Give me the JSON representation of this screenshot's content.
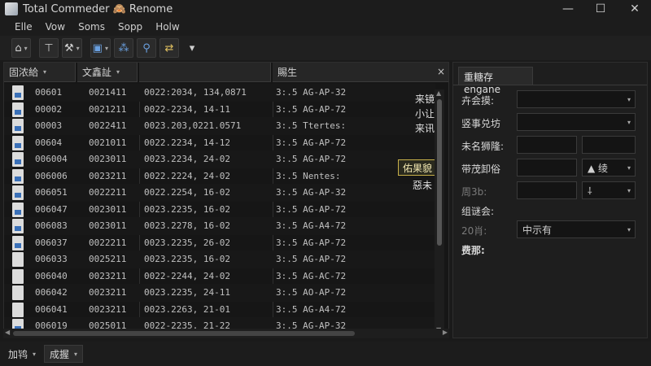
{
  "window": {
    "title": "Total Commeder 🙈 Renome",
    "minimize_glyph": "—",
    "maximize_glyph": "☐",
    "close_glyph": "✕"
  },
  "menu": [
    "Elle",
    "Vow",
    "Soms",
    "Sopp",
    "Holw"
  ],
  "toolbar": {
    "icons": [
      "home-icon",
      "filter-icon",
      "tools-icon",
      "view-icon",
      "network-icon",
      "search-icon",
      "sync-icon"
    ],
    "home_glyph": "⌂",
    "filter_glyph": "⊤",
    "tools_glyph": "⚒",
    "view_glyph": "▣",
    "network_glyph": "⁂",
    "search_glyph": "⚲",
    "sync_glyph": "⇄",
    "more_glyph": "▾"
  },
  "file_list": {
    "headers": [
      "固浓給",
      "文鑫訨",
      "",
      "賜生"
    ],
    "rows": [
      {
        "id": "00601",
        "code": "0021411",
        "date": "0022:2034, 134,0871",
        "attr": "3:.5 AG-AP-32",
        "icon": "dark"
      },
      {
        "id": "00002",
        "code": "0021211",
        "date": "0022-2234, 14-11",
        "attr": "3:.5 AG-AP-72",
        "icon": "dark"
      },
      {
        "id": "00003",
        "code": "0022411",
        "date": "0023.203,0221.0571",
        "attr": "3:.5 Ttertes:",
        "icon": "dark"
      },
      {
        "id": "00604",
        "code": "0021011",
        "date": "0022.2234, 14-12",
        "attr": "3:.5 AG-AP-72",
        "icon": "dark"
      },
      {
        "id": "006004",
        "code": "0023011",
        "date": "0023.2234, 24-02",
        "attr": "3:.5 AG-AP-72",
        "icon": "dark"
      },
      {
        "id": "006006",
        "code": "0023211",
        "date": "0022.2224, 24-02",
        "attr": "3:.5 Nentes:",
        "icon": "dark"
      },
      {
        "id": "006051",
        "code": "0022211",
        "date": "0022.2254, 16-02",
        "attr": "3:.5 AG-AP-32",
        "icon": "dark"
      },
      {
        "id": "006047",
        "code": "0023011",
        "date": "0023.2235, 16-02",
        "attr": "3:.5 AG-AP-72",
        "icon": "dark"
      },
      {
        "id": "006083",
        "code": "0023011",
        "date": "0023.2278, 16-02",
        "attr": "3:.5 AG-A4-72",
        "icon": "dark"
      },
      {
        "id": "006037",
        "code": "0022211",
        "date": "0023.2235, 26-02",
        "attr": "3:.5 AG-AP-72",
        "icon": "dark"
      },
      {
        "id": "006033",
        "code": "0025211",
        "date": "0023.2235, 16-02",
        "attr": "3:.5 AG-AP-72",
        "icon": "light"
      },
      {
        "id": "006040",
        "code": "0023211",
        "date": "0022-2244, 24-02",
        "attr": "3:.5 AG-AC-72",
        "icon": "light"
      },
      {
        "id": "006042",
        "code": "0023211",
        "date": "0023.2235, 24-11",
        "attr": "3:.5 AO-AP-72",
        "icon": "light"
      },
      {
        "id": "006041",
        "code": "0023211",
        "date": "0023.2263, 21-01",
        "attr": "3:.5 AG-A4-72",
        "icon": "light"
      },
      {
        "id": "006019",
        "code": "0025011",
        "date": "0022-2235, 21-22",
        "attr": "3:.5 AG-AP-32",
        "icon": "dark"
      }
    ],
    "side_notes": [
      "来镜",
      "小让",
      "来讯"
    ],
    "highlight": "佑果貌",
    "highlight_note": "惡未",
    "close_glyph": "×"
  },
  "properties": {
    "tab": "重糖存engane",
    "labels": {
      "l1": "卉会摸:",
      "l2": "竖事兑坊",
      "l3": "未名狮隆:",
      "l4": "带茂卸俗",
      "l5": "周3b:",
      "l6": "组谜会:",
      "l7": "20肖:",
      "l8": "费那:"
    },
    "values": {
      "sort": "▲ 绫",
      "symbol": "⸸",
      "select": "中示有"
    }
  },
  "status": {
    "left": "加鸨",
    "right": "成握"
  }
}
